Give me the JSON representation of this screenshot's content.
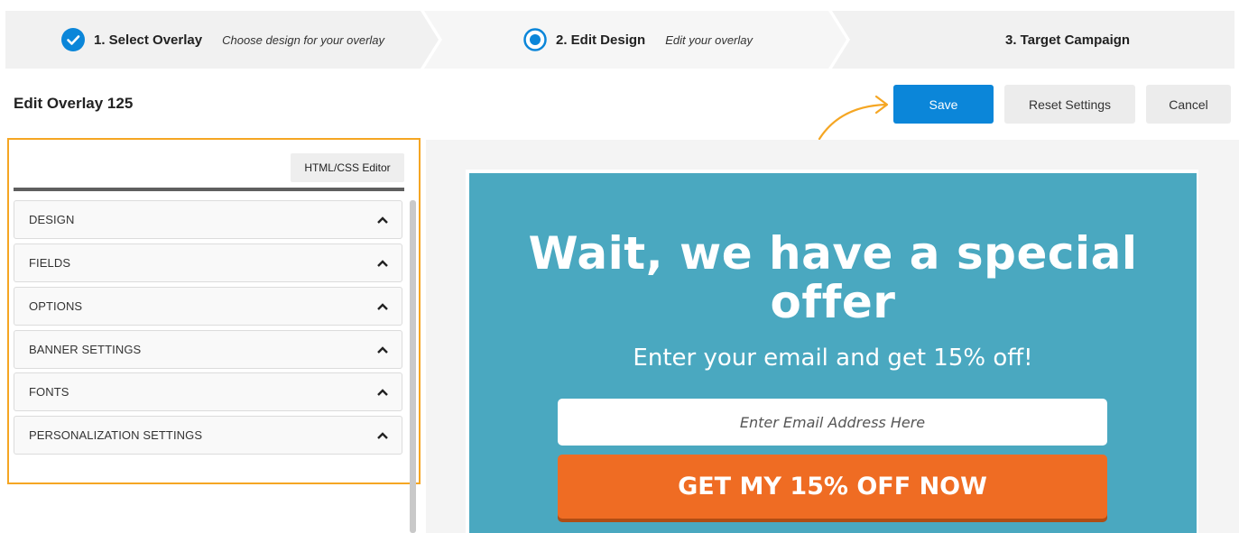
{
  "stepper": {
    "steps": [
      {
        "title": "1. Select Overlay",
        "subtitle": "Choose design for your overlay",
        "state": "completed",
        "icon": "check-circle-icon"
      },
      {
        "title": "2. Edit Design",
        "subtitle": "Edit your overlay",
        "state": "active",
        "icon": "radio-active-icon"
      },
      {
        "title": "3. Target Campaign",
        "subtitle": "",
        "state": "upcoming",
        "icon": ""
      }
    ]
  },
  "header": {
    "title": "Edit Overlay 125",
    "save_label": "Save",
    "reset_label": "Reset Settings",
    "cancel_label": "Cancel"
  },
  "settings": {
    "html_editor_label": "HTML/CSS Editor",
    "sections": [
      {
        "label": "DESIGN"
      },
      {
        "label": "FIELDS"
      },
      {
        "label": "OPTIONS"
      },
      {
        "label": "BANNER SETTINGS"
      },
      {
        "label": "FONTS"
      },
      {
        "label": "PERSONALIZATION SETTINGS"
      }
    ]
  },
  "preview": {
    "heading": "Wait, we have a special offer",
    "subheading": "Enter your email and get 15% off!",
    "email_placeholder": "Enter Email Address Here",
    "cta_label": "GET MY 15% OFF NOW"
  },
  "colors": {
    "accent_blue": "#0b86d9",
    "panel_highlight": "#f5a623",
    "overlay_bg": "#4aa8c0",
    "cta_orange": "#ef6c23"
  }
}
